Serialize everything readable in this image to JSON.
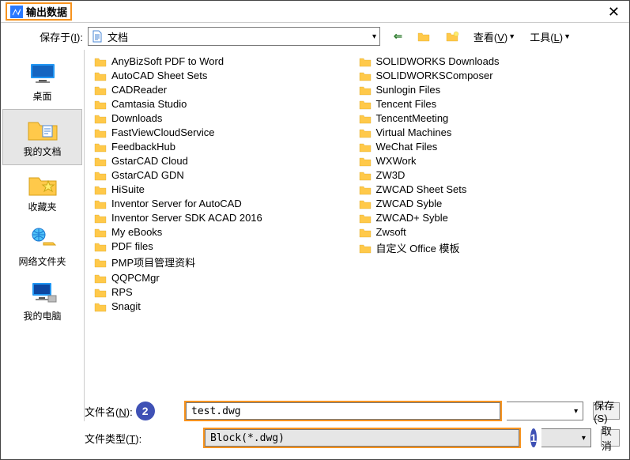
{
  "title": "输出数据",
  "toolbar": {
    "save_in_label_pre": "保存于(",
    "save_in_label_u": "I",
    "save_in_label_post": "):",
    "path_display": "文档",
    "view_pre": "查看(",
    "view_u": "V",
    "view_post": ")",
    "tools_pre": "工具(",
    "tools_u": "L",
    "tools_post": ")"
  },
  "sidebar": {
    "items": [
      {
        "label": "桌面"
      },
      {
        "label": "我的文档"
      },
      {
        "label": "收藏夹"
      },
      {
        "label": "网络文件夹"
      },
      {
        "label": "我的电脑"
      }
    ]
  },
  "files": {
    "col1": [
      "AnyBizSoft PDF to Word",
      "AutoCAD Sheet Sets",
      "CADReader",
      "Camtasia Studio",
      "Downloads",
      "FastViewCloudService",
      "FeedbackHub",
      "GstarCAD Cloud",
      "GstarCAD GDN",
      "HiSuite",
      "Inventor Server for AutoCAD",
      "Inventor Server SDK ACAD 2016",
      "My eBooks",
      "PDF files",
      "PMP项目管理资料",
      "QQPCMgr",
      "RPS",
      "Snagit"
    ],
    "col2": [
      "SOLIDWORKS Downloads",
      "SOLIDWORKSComposer",
      "Sunlogin Files",
      "Tencent Files",
      "TencentMeeting",
      "Virtual Machines",
      "WeChat Files",
      "WXWork",
      "ZW3D",
      "ZWCAD Sheet Sets",
      "ZWCAD Syble",
      "ZWCAD+ Syble",
      "Zwsoft",
      "自定义 Office 模板"
    ]
  },
  "bottom": {
    "fname_label_pre": "文件名(",
    "fname_label_u": "N",
    "fname_label_post": "):",
    "fname_value": "test.dwg",
    "ftype_label_pre": "文件类型(",
    "ftype_label_u": "T",
    "ftype_label_post": "):",
    "ftype_value": "Block(*.dwg)",
    "save_btn": "保存(S)",
    "cancel_btn": "取消",
    "badge1": "1",
    "badge2": "2"
  }
}
